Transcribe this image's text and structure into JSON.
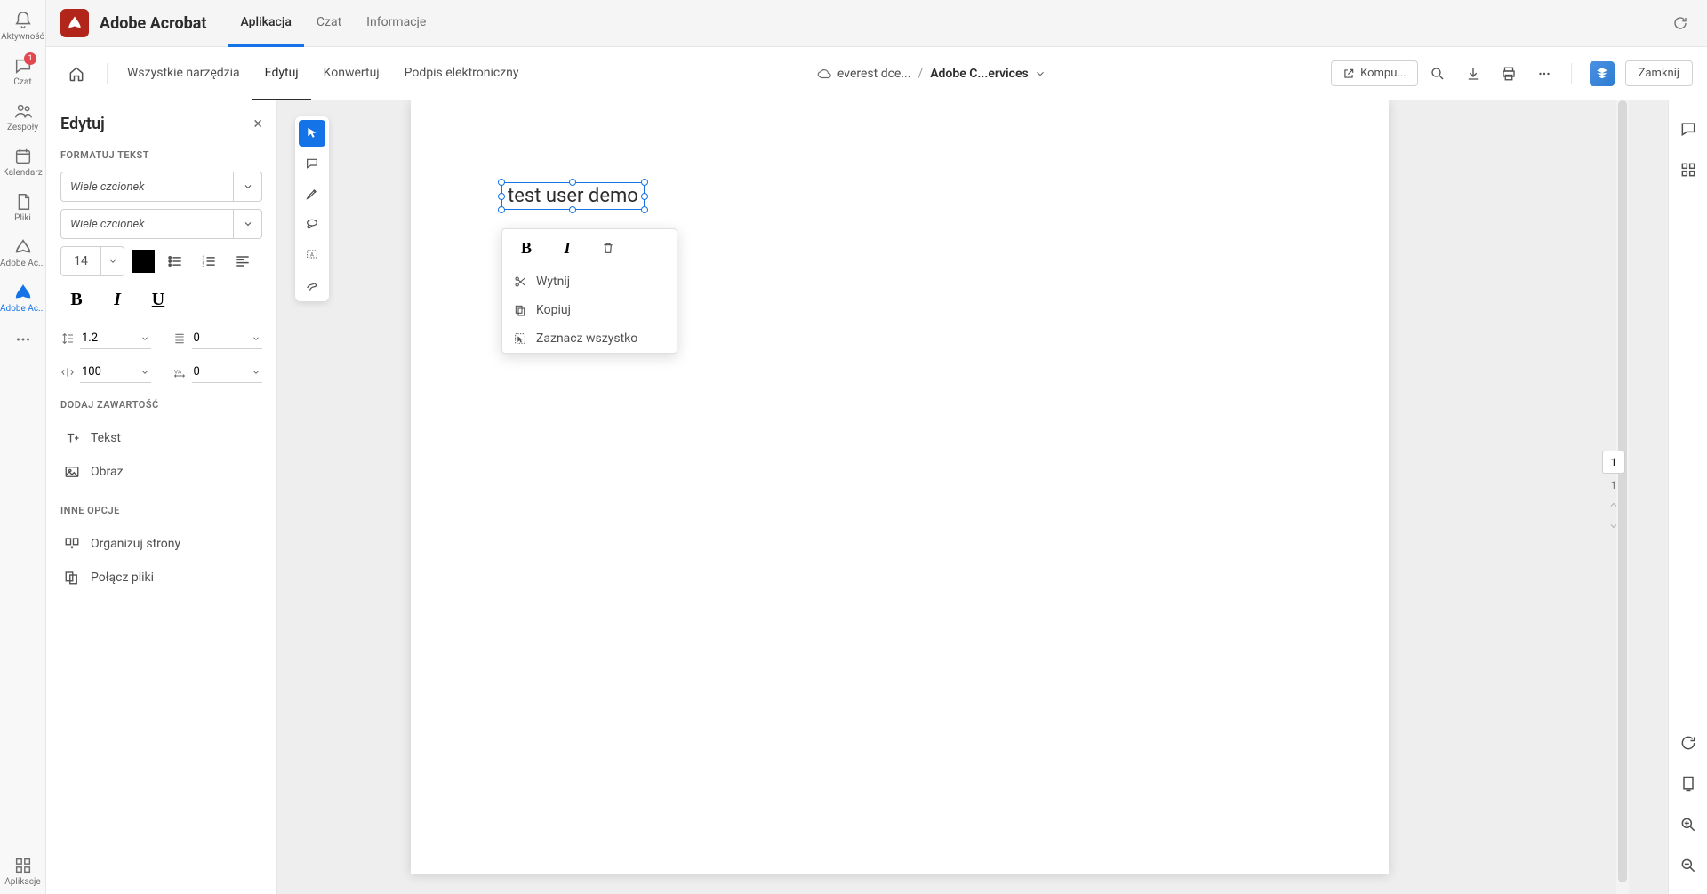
{
  "leftRail": {
    "activity": "Aktywność",
    "chat": "Czat",
    "chatBadge": "1",
    "teams": "Zespoły",
    "calendar": "Kalendarz",
    "files": "Pliki",
    "acrobat1": "Adobe Ac...",
    "acrobat2": "Adobe Ac...",
    "apps": "Aplikacje"
  },
  "header": {
    "appTitle": "Adobe Acrobat",
    "tabs": {
      "app": "Aplikacja",
      "chat": "Czat",
      "info": "Informacje"
    }
  },
  "toolbar": {
    "allTools": "Wszystkie narzędzia",
    "edit": "Edytuj",
    "convert": "Konwertuj",
    "esign": "Podpis elektroniczny",
    "crumbCloud": "everest dce...",
    "crumbSep": "/",
    "crumbDoc": "Adobe C...ervices",
    "computer": "Kompu...",
    "close": "Zamknij"
  },
  "panel": {
    "title": "Edytuj",
    "formatText": "FORMATUJ TEKST",
    "fontMulti": "Wiele czcionek",
    "styleMulti": "Wiele czcionek",
    "size": "14",
    "lineHeight": "1.2",
    "paraSpacing": "0",
    "charScale": "100",
    "tracking": "0",
    "addContent": "DODAJ ZAWARTOŚĆ",
    "text": "Tekst",
    "image": "Obraz",
    "otherOptions": "INNE OPCJE",
    "organize": "Organizuj strony",
    "combine": "Połącz pliki"
  },
  "canvas": {
    "textContent": "test user demo"
  },
  "contextMenu": {
    "cut": "Wytnij",
    "copy": "Kopiuj",
    "selectAll": "Zaznacz wszystko"
  },
  "pageInd": {
    "current": "1",
    "total": "1"
  }
}
